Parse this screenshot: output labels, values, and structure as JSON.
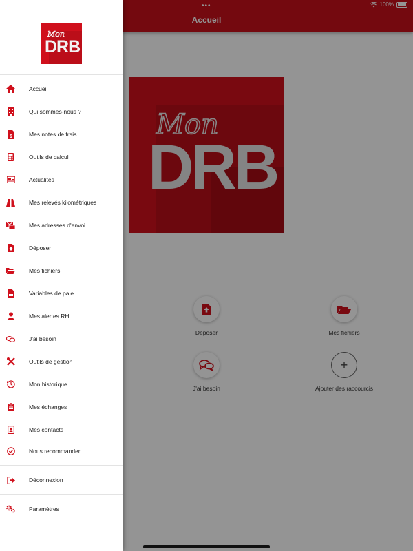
{
  "status_bar": {
    "battery": "100%"
  },
  "header": {
    "title": "Accueil"
  },
  "logo": {
    "script_text": "Mon",
    "main_text": "DRB"
  },
  "shortcuts": [
    {
      "label": "Déposer",
      "icon": "upload-file-icon"
    },
    {
      "label": "Mes fichiers",
      "icon": "folder-open-icon"
    },
    {
      "label": "J'ai besoin",
      "icon": "chat-bubbles-icon"
    },
    {
      "label": "Ajouter des raccourcis",
      "icon": "plus-icon"
    }
  ],
  "menu": [
    {
      "label": "Accueil",
      "icon": "home-icon"
    },
    {
      "label": "Qui sommes-nous ?",
      "icon": "building-icon"
    },
    {
      "label": "Mes notes de frais",
      "icon": "receipt-icon"
    },
    {
      "label": "Outils de calcul",
      "icon": "calculator-icon"
    },
    {
      "label": "Actualités",
      "icon": "newspaper-icon"
    },
    {
      "label": "Mes relevés kilométriques",
      "icon": "road-icon"
    },
    {
      "label": "Mes adresses d'envoi",
      "icon": "mail-address-icon"
    },
    {
      "label": "Déposer",
      "icon": "upload-file-icon"
    },
    {
      "label": "Mes fichiers",
      "icon": "folder-open-icon"
    },
    {
      "label": "Variables de paie",
      "icon": "document-icon"
    },
    {
      "label": "Mes alertes RH",
      "icon": "user-alert-icon"
    },
    {
      "label": "J'ai besoin",
      "icon": "chat-bubbles-icon"
    },
    {
      "label": "Outils de gestion",
      "icon": "tools-icon"
    },
    {
      "label": "Mon historique",
      "icon": "history-icon"
    },
    {
      "label": "Mes échanges",
      "icon": "clipboard-icon"
    },
    {
      "label": "Mes contacts",
      "icon": "contact-card-icon"
    },
    {
      "label": "Nous recommander",
      "icon": "check-circle-icon"
    }
  ],
  "footer_menu": [
    {
      "label": "Déconnexion",
      "icon": "logout-icon"
    },
    {
      "label": "Paramètres",
      "icon": "settings-icon"
    }
  ],
  "colors": {
    "brand": "#c8101b",
    "icon": "#d0101c"
  }
}
